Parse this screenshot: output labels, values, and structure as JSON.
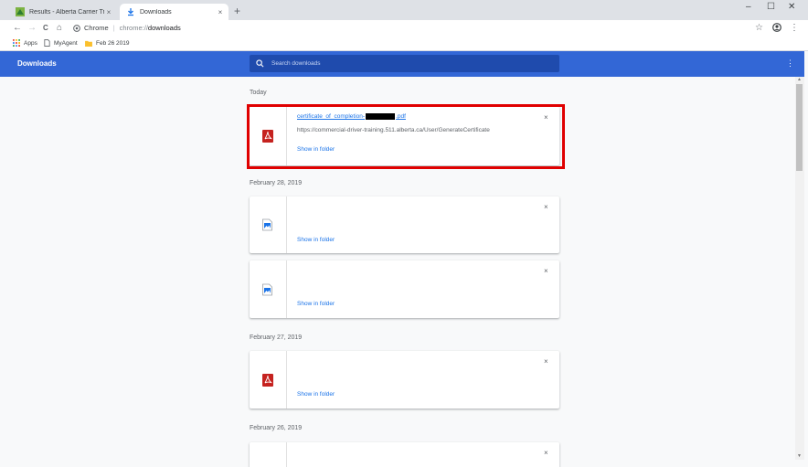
{
  "tabs": [
    {
      "title": "Results - Alberta Carrier Training",
      "close": "×"
    },
    {
      "title": "Downloads",
      "close": "×"
    }
  ],
  "new_tab": "+",
  "window_controls": {
    "minimize": "–",
    "maximize": "☐",
    "close": "✕"
  },
  "toolbar": {
    "back": "←",
    "forward": "→",
    "reload": "C",
    "home": "⌂",
    "site_label": "Chrome",
    "separator": "|",
    "url_scheme": "chrome://",
    "url_path": "downloads",
    "star": "☆",
    "menu": "⋮"
  },
  "bookmarks": [
    {
      "label": "Apps"
    },
    {
      "label": "MyAgent"
    },
    {
      "label": "Feb 26 2019"
    }
  ],
  "downloads_header": {
    "title": "Downloads",
    "search_placeholder": "Search downloads",
    "menu": "⋮"
  },
  "groups": [
    {
      "date": "Today",
      "items": [
        {
          "type": "pdf",
          "name_prefix": "certificate_of_completion-",
          "name_suffix": ".pdf",
          "url": "https://commercial-driver-training.511.alberta.ca/User/GenerateCertificate",
          "show_in_folder": "Show in folder",
          "close": "×"
        }
      ]
    },
    {
      "date": "February 28, 2019",
      "items": [
        {
          "type": "image",
          "show_in_folder": "Show in folder",
          "close": "×"
        },
        {
          "type": "image",
          "show_in_folder": "Show in folder",
          "close": "×"
        }
      ]
    },
    {
      "date": "February 27, 2019",
      "items": [
        {
          "type": "pdf",
          "show_in_folder": "Show in folder",
          "close": "×"
        }
      ]
    },
    {
      "date": "February 26, 2019",
      "items": [
        {
          "type": "unknown",
          "close": "×"
        }
      ]
    }
  ],
  "colors": {
    "header_blue": "#3367d6",
    "link_blue": "#1a73e8",
    "pdf_red": "#c5221f",
    "highlight_red": "#e00000"
  }
}
